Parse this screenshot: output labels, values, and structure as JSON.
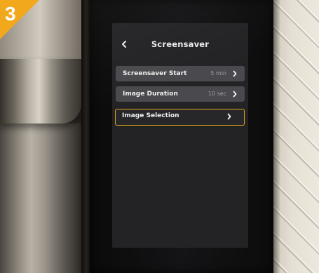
{
  "step_badge": {
    "number": "3",
    "color": "#f2a81d"
  },
  "screen": {
    "title": "Screensaver",
    "back_icon": "chevron-left-icon",
    "accent_color": "#e0a21c",
    "items": [
      {
        "label": "Screensaver Start",
        "value": "5 min",
        "icon": "chevron-right-icon",
        "selected": false
      },
      {
        "label": "Image Duration",
        "value": "10 sec",
        "icon": "chevron-right-icon",
        "selected": false
      },
      {
        "label": "Image Selection",
        "value": "",
        "icon": "chevron-right-icon",
        "selected": true
      }
    ]
  }
}
